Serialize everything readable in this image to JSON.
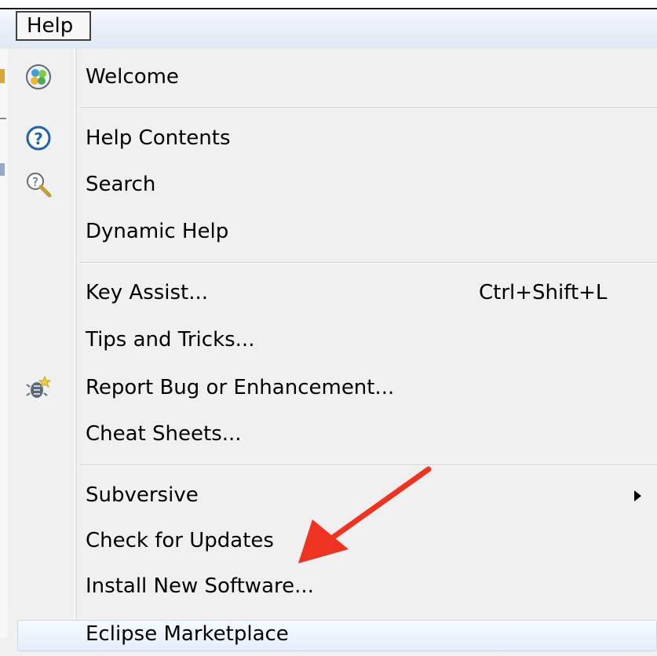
{
  "menubar": {
    "help_title": "Help"
  },
  "help_menu": {
    "items": [
      {
        "label": "Welcome",
        "icon": "welcome-icon"
      },
      {
        "label": "Help Contents",
        "icon": "question-icon"
      },
      {
        "label": "Search",
        "icon": "search-help-icon"
      },
      {
        "label": "Dynamic Help"
      },
      {
        "label": "Key Assist...",
        "shortcut": "Ctrl+Shift+L"
      },
      {
        "label": "Tips and Tricks..."
      },
      {
        "label": "Report Bug or Enhancement...",
        "icon": "bug-report-icon"
      },
      {
        "label": "Cheat Sheets..."
      },
      {
        "label": "Subversive",
        "submenu": true
      },
      {
        "label": "Check for Updates"
      },
      {
        "label": "Install New Software..."
      },
      {
        "label": "Eclipse Marketplace"
      }
    ]
  },
  "colors": {
    "annotation_arrow": "#ee3322",
    "menu_background": "#f0f0f0",
    "separator": "#d0d0d0"
  }
}
